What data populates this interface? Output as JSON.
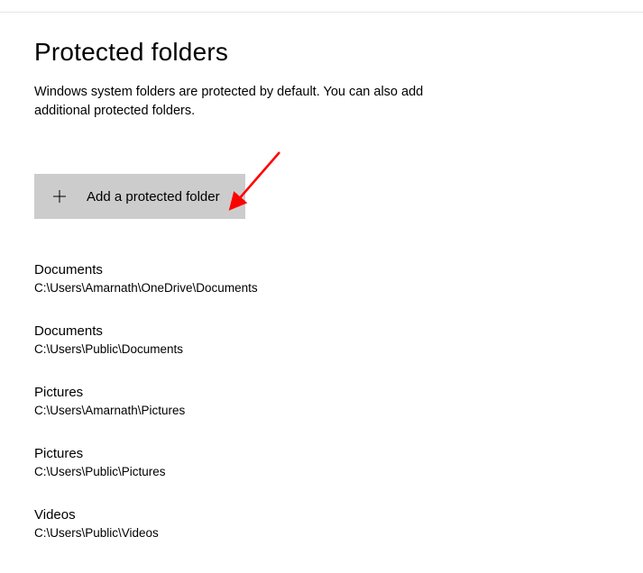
{
  "header": {
    "title": "Protected folders",
    "description": "Windows system folders are protected by default. You can also add additional protected folders."
  },
  "actions": {
    "add_button_label": "Add a protected folder"
  },
  "folders": [
    {
      "name": "Documents",
      "path": "C:\\Users\\Amarnath\\OneDrive\\Documents"
    },
    {
      "name": "Documents",
      "path": "C:\\Users\\Public\\Documents"
    },
    {
      "name": "Pictures",
      "path": "C:\\Users\\Amarnath\\Pictures"
    },
    {
      "name": "Pictures",
      "path": "C:\\Users\\Public\\Pictures"
    },
    {
      "name": "Videos",
      "path": "C:\\Users\\Public\\Videos"
    }
  ],
  "annotation": {
    "arrow_color": "#ff0000"
  }
}
